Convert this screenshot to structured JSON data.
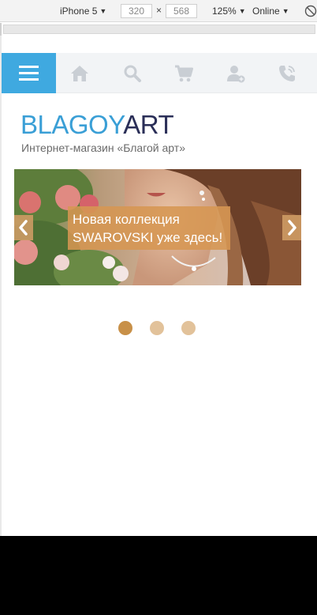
{
  "devtools": {
    "device": "iPhone 5",
    "width": "320",
    "height": "568",
    "times": "×",
    "zoom": "125%",
    "network": "Online"
  },
  "site": {
    "logo": {
      "part1": "BLAGOY",
      "part2": "ART"
    },
    "tagline": "Интернет-магазин «Благой арт»",
    "nav_icons": [
      "menu-icon",
      "home-icon",
      "search-icon",
      "cart-icon",
      "user-add-icon",
      "phone-icon"
    ],
    "colors": {
      "accent": "#3fa9e0",
      "logo_blue": "#3a9fd6",
      "logo_dark": "#2b2f58",
      "caption_bg": "#d69652",
      "dot_active": "#c89048",
      "dot_inactive": "#e2c29a"
    }
  },
  "banner": {
    "caption_line1": "Новая коллекция",
    "caption_line2": "SWAROVSKI уже здесь!"
  },
  "slider": {
    "total": 3,
    "active": 1
  }
}
